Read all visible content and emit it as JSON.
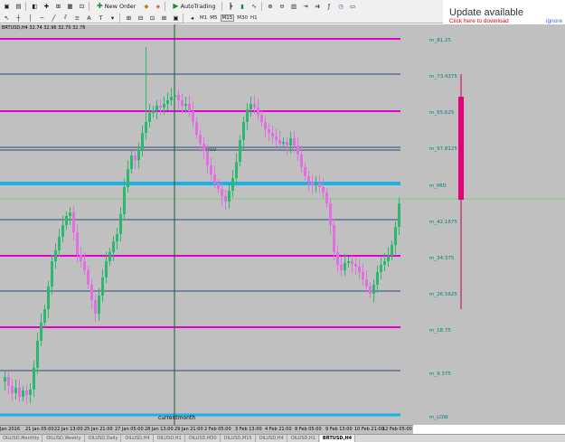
{
  "toolbar": {
    "new_order": "New Order",
    "auto_trading": "AutoTrading",
    "timeframes": [
      "M1",
      "M5",
      "M15",
      "M30",
      "H1"
    ],
    "active_timeframe": "M15"
  },
  "update": {
    "title": "Update available",
    "link": "Click here to download",
    "ignore": "ignore"
  },
  "chart": {
    "symbol_info": "BRTUSD,H4  32.74 32.96 32.70 32.76",
    "current_month_label": "currentmonth",
    "small_label_1": "m59",
    "levels": [
      "m_81.25",
      "m_73.4375",
      "m_65.625",
      "m_57.8125",
      "m_MID",
      "m_42.1875",
      "m_34.375",
      "m_26.5625",
      "m_18.75",
      "m_9.375",
      "m_LOW"
    ],
    "colors": {
      "background": "#c0c0c0",
      "bull": "#2db870",
      "bear": "#e070e0",
      "mid_line": "#1ab0e8",
      "magenta_line": "#e000d0",
      "navy_line": "#2a4a78",
      "indicator": "#e8007a"
    }
  },
  "axis": {
    "labels": [
      "Jan 2016",
      "21 Jan 05:00",
      "22 Jan 13:00",
      "25 Jan 21:00",
      "27 Jan 05:00",
      "28 Jan 13:00",
      "29 Jan 21:00",
      "2 Feb 05:00",
      "3 Feb 13:00",
      "4 Feb 21:00",
      "8 Feb 05:00",
      "9 Feb 13:00",
      "10 Feb 21:00",
      "12 Feb 05:00"
    ]
  },
  "tabs": [
    "OILUSD,Monthly",
    "OILUSD,Weekly",
    "OILUSD,Daily",
    "OILUSD,H4",
    "OILUSD,H1",
    "OILUSD,M30",
    "OILUSD,M15",
    "OILUSD,H4",
    "OILUSD,H1",
    "BRTUSD,H4"
  ],
  "active_tab": "BRTUSD,H4"
}
